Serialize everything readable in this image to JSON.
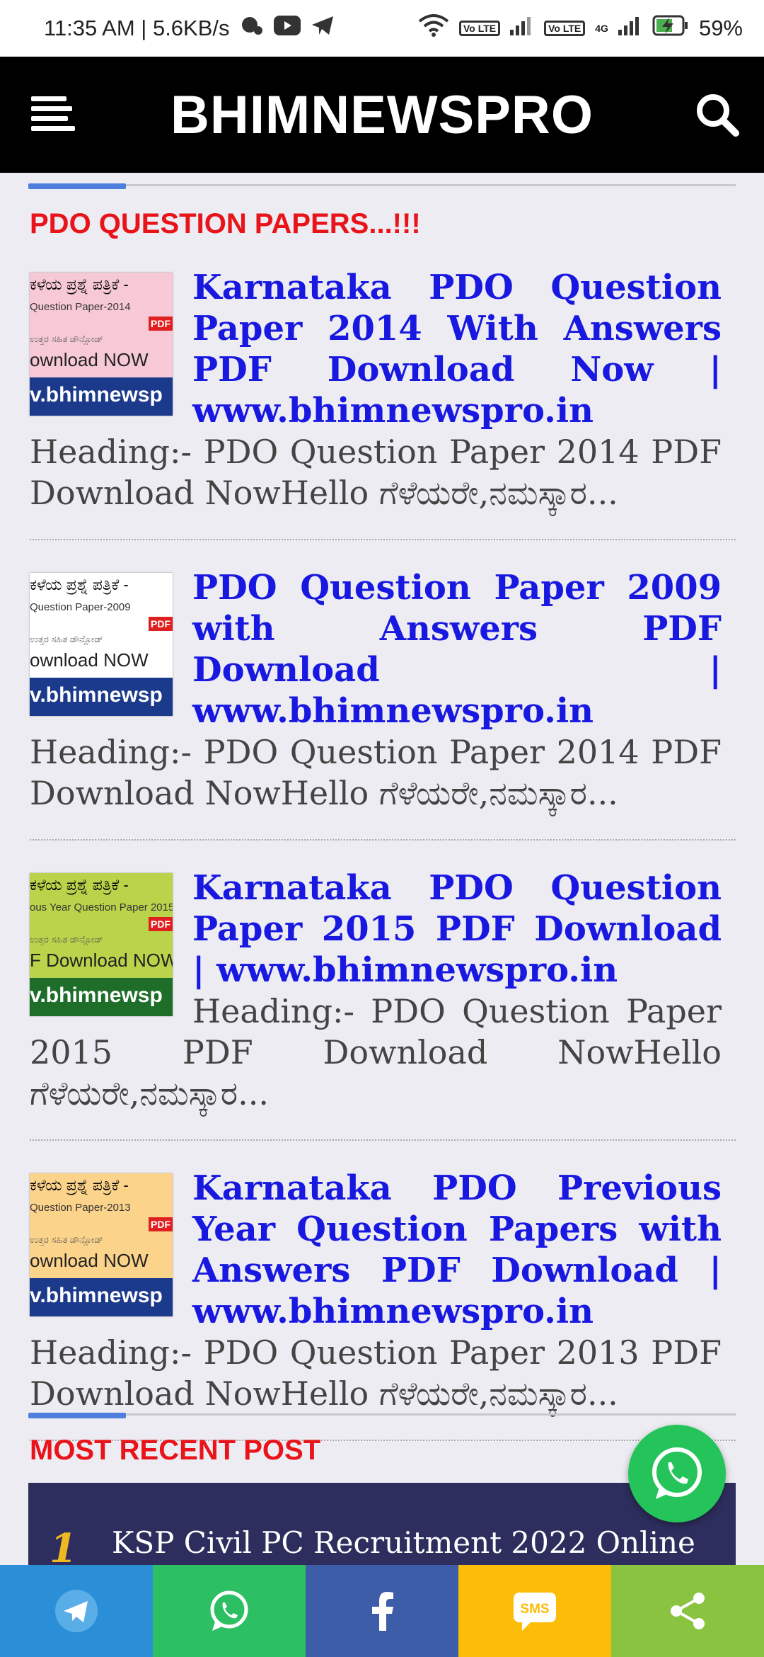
{
  "status_bar": {
    "time_speed": "11:35 AM | 5.6KB/s",
    "network_badges": [
      "Vo LTE",
      "Vo LTE"
    ],
    "network_4g": "4G",
    "battery": "59%"
  },
  "header": {
    "site_title": "BHIMNEWSPRO",
    "menu_icon": "hamburger-icon",
    "search_icon": "search-icon"
  },
  "section1": {
    "title": "PDO QUESTION PAPERS...!!!"
  },
  "posts": [
    {
      "title": "Karnataka PDO Question Paper 2014 With Answers PDF Download Now | www.bhimnewspro.in",
      "snippet": "Heading:- PDO Question Paper 2014 PDF Download NowHello ಗೆಳೆಯರೇ,ನಮಸ್ಕಾರ...",
      "thumb": {
        "line1": "ಕಳೆಯ ಪ್ರಶ್ನೆ ಪತ್ರಿಕೆ -",
        "line2": "Question Paper-2014",
        "line3": "ಉತ್ತರ ಸಹಿತ ಡೌನ್ಲೋಡ್",
        "line4": "ownload NOW",
        "badge": "PDF",
        "brand": "v.bhimnewsp",
        "bg": "#f7c9d6"
      }
    },
    {
      "title": "PDO Question Paper 2009 with Answers PDF Download | www.bhimnewspro.in",
      "snippet": "Heading:- PDO Question Paper 2014 PDF Download NowHello ಗೆಳೆಯರೇ,ನಮಸ್ಕಾರ...",
      "thumb": {
        "line1": "ಕಳೆಯ ಪ್ರಶ್ನೆ ಪತ್ರಿಕೆ -",
        "line2": "Question Paper-2009",
        "line3": "ಉತ್ತರ ಸಹಿತ ಡೌನ್ಲೋಡ್",
        "line4": "ownload NOW",
        "badge": "PDF",
        "brand": "v.bhimnewsp",
        "bg": "#ffffff"
      }
    },
    {
      "title": "Karnataka PDO Question Paper 2015 PDF Download | www.bhimnewspro.in",
      "snippet": "Heading:- PDO Question Paper 2015 PDF Download NowHello ಗೆಳೆಯರೇ,ನಮಸ್ಕಾರ...",
      "thumb": {
        "line1": "ಕಳೆಯ ಪ್ರಶ್ನೆ ಪತ್ರಿಕೆ -",
        "line2": "ous Year Question Paper 2015",
        "line3": "ಉತ್ತರ ಸಹಿತ ಡೌನ್ಲೋಡ್",
        "line4": "F Download NOW",
        "badge": "PDF",
        "brand": "v.bhimnewsp",
        "bg": "#b9d44a"
      }
    },
    {
      "title": "Karnataka PDO Previous Year Question Papers with Answers PDF Download | www.bhimnewspro.in",
      "snippet": "Heading:- PDO Question Paper 2013 PDF Download NowHello ಗೆಳೆಯರೇ,ನಮಸ್ಕಾರ...",
      "thumb": {
        "line1": "ಕಳೆಯ ಪ್ರಶ್ನೆ ಪತ್ರಿಕೆ -",
        "line2": "Question Paper-2013",
        "line3": "ಉತ್ತರ ಸಹಿತ ಡೌನ್ಲೋಡ್",
        "line4": "ownload NOW",
        "badge": "PDF",
        "brand": "v.bhimnewsp",
        "bg": "#fcd38a"
      }
    }
  ],
  "section2": {
    "title": "MOST RECENT POST"
  },
  "recent": {
    "number": "1",
    "text": "KSP Civil PC Recruitment 2022 Online"
  },
  "share_bar": [
    {
      "name": "telegram-share",
      "icon": "telegram-icon",
      "color": "#2b8fd8"
    },
    {
      "name": "whatsapp-share",
      "icon": "whatsapp-icon",
      "color": "#2dbf63"
    },
    {
      "name": "facebook-share",
      "icon": "facebook-icon",
      "color": "#3d5da8"
    },
    {
      "name": "sms-share",
      "icon": "sms-icon",
      "color": "#fbbd08",
      "label": "SMS"
    },
    {
      "name": "more-share",
      "icon": "share-icon",
      "color": "#8ac33f"
    }
  ],
  "colors": {
    "accent_red": "#e8141a",
    "link_blue": "#1818e0",
    "header_bg": "#000000",
    "section_bar": "#4f7fdc"
  }
}
